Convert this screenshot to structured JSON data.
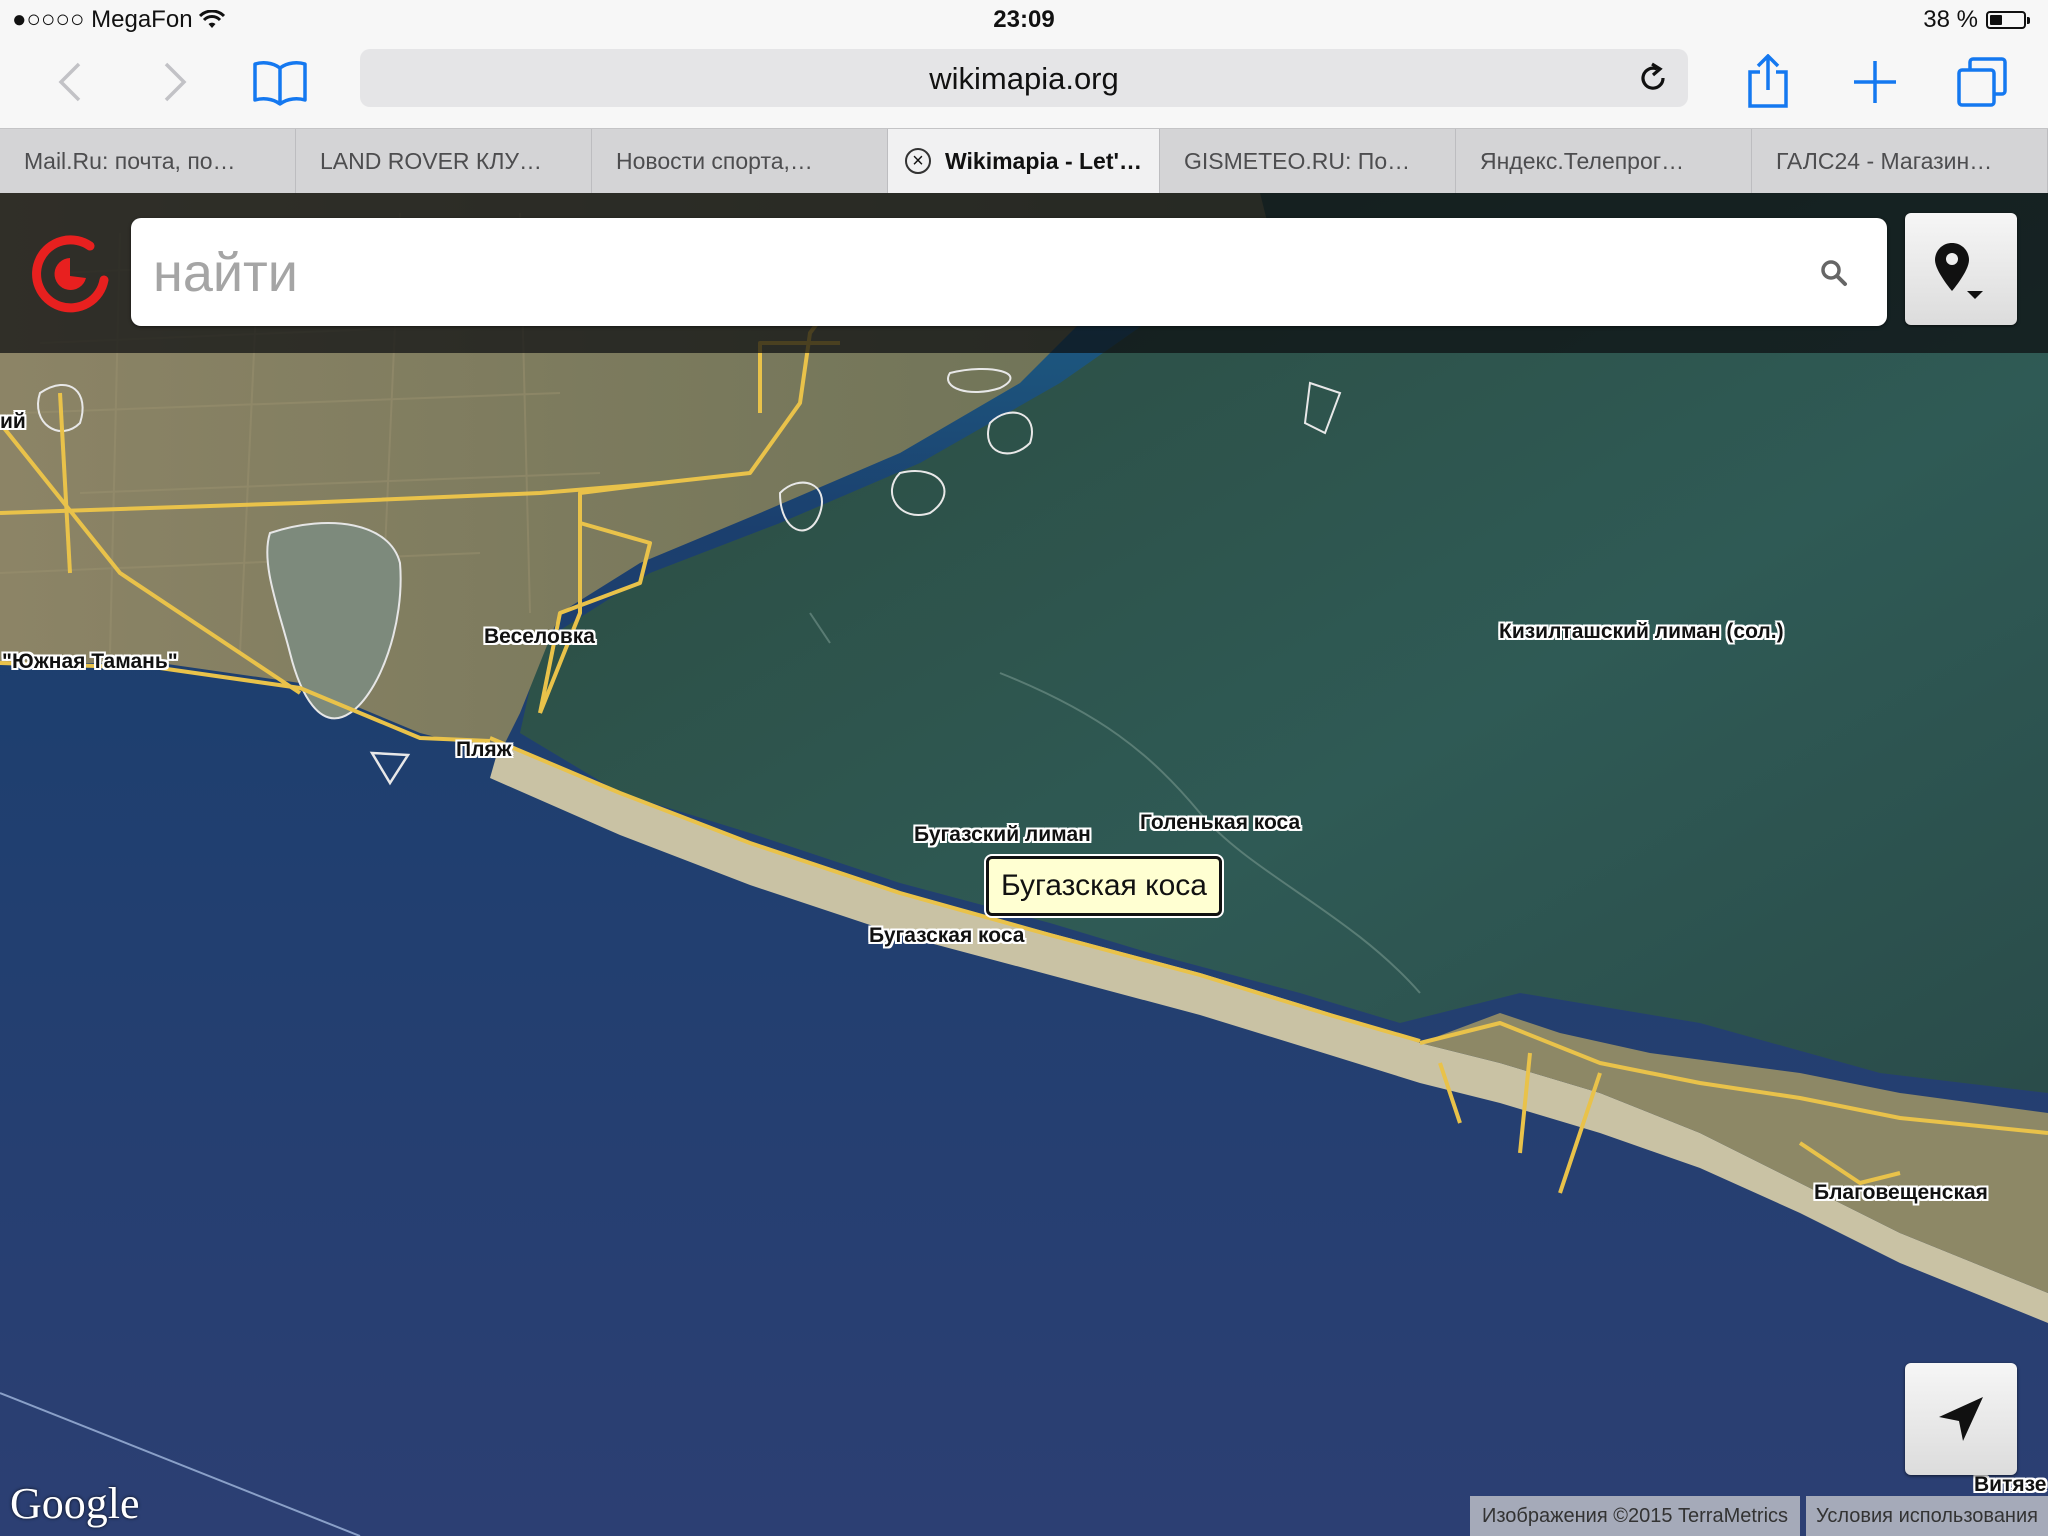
{
  "status_bar": {
    "carrier": "●○○○○ MegaFon",
    "time": "23:09",
    "battery_text": "38 %",
    "battery_level": 0.38
  },
  "browser": {
    "url": "wikimapia.org",
    "tabs": [
      {
        "title": "Mail.Ru: почта, по…",
        "active": false
      },
      {
        "title": "LAND ROVER КЛУ…",
        "active": false
      },
      {
        "title": "Новости спорта,…",
        "active": false
      },
      {
        "title": "Wikimapia - Let'…",
        "active": true
      },
      {
        "title": "GISMETEO.RU: По…",
        "active": false
      },
      {
        "title": "Яндекс.Телепрог…",
        "active": false
      },
      {
        "title": "ГАЛС24 - Магазин…",
        "active": false
      }
    ]
  },
  "wikimapia": {
    "search_placeholder": "найти",
    "accent_color": "#e8201f"
  },
  "map": {
    "labels": {
      "yuzhnaya": "\"Южная Тамань\"",
      "veselovka": "Веселовка",
      "plyazh": "Пляж",
      "kiziltash": "Кизилташский лиман (сол.)",
      "bugazsky_liman": "Бугазский лиман",
      "golenkaya": "Голенькая коса",
      "bugazskaya": "Бугазская коса",
      "blagoveshchenskaya": "Благовещенская",
      "vityaz": "Витязе",
      "left_cut": "ий"
    },
    "tooltip": "Бугазская коса",
    "attribution": "Изображения ©2015 TerraMetrics",
    "terms": "Условия использования",
    "google_logo": "Google"
  }
}
